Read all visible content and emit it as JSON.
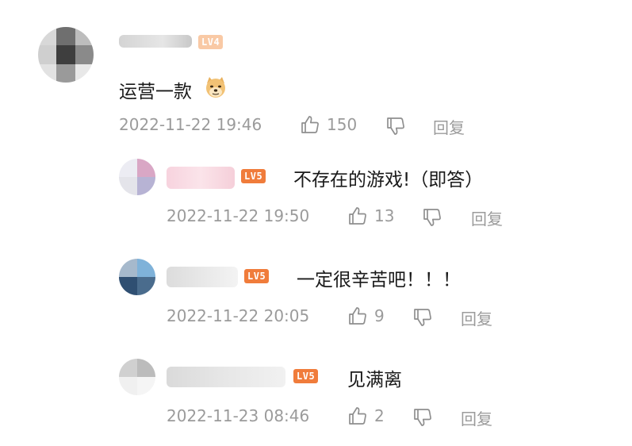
{
  "comments": [
    {
      "username_visible": false,
      "level_badge": "LV4",
      "text": "运营一款",
      "emoji": "doge-face-icon",
      "timestamp": "2022-11-22 19:46",
      "likes": "150",
      "reply_label": "回复"
    },
    {
      "username_visible": false,
      "level_badge": "LV5",
      "text": "不存在的游戏!（即答）",
      "timestamp": "2022-11-22 19:50",
      "likes": "13",
      "reply_label": "回复"
    },
    {
      "username_visible": false,
      "level_badge": "LV5",
      "text": "一定很辛苦吧！！！",
      "timestamp": "2022-11-22 20:05",
      "likes": "9",
      "reply_label": "回复"
    },
    {
      "username_visible": false,
      "level_badge": "LV5",
      "text": "见满离",
      "timestamp": "2022-11-23 08:46",
      "likes": "2",
      "reply_label": "回复"
    }
  ],
  "colors": {
    "badge_light": "#f9c9a5",
    "badge_orange": "#f07c3b",
    "meta_gray": "#9b9b9b",
    "text": "#1a1a1a"
  }
}
